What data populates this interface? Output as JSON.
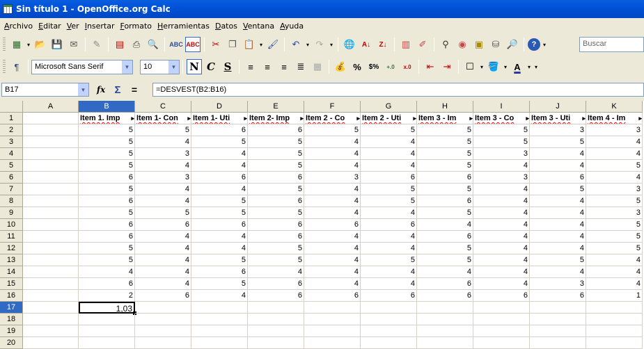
{
  "window": {
    "title": "Sin título 1 - OpenOffice.org Calc"
  },
  "menu": [
    "Archivo",
    "Editar",
    "Ver",
    "Insertar",
    "Formato",
    "Herramientas",
    "Datos",
    "Ventana",
    "Ayuda"
  ],
  "toolbar": {
    "search_placeholder": "Buscar",
    "font_name": "Microsoft Sans Serif",
    "font_size": "10",
    "bold_label": "N",
    "italic_label": "C",
    "underline_label": "S",
    "percent_label": "%"
  },
  "formula_bar": {
    "cell_ref": "B17",
    "formula": "=DESVEST(B2:B16)",
    "fx_label": "fx",
    "sum_label": "Σ",
    "equals_label": "="
  },
  "sheet": {
    "columns": [
      "A",
      "B",
      "C",
      "D",
      "E",
      "F",
      "G",
      "H",
      "I",
      "J",
      "K"
    ],
    "selected_column": "B",
    "selected_row": 17,
    "rows": [
      "1",
      "2",
      "3",
      "4",
      "5",
      "6",
      "7",
      "8",
      "9",
      "10",
      "11",
      "12",
      "13",
      "14",
      "15",
      "16",
      "17",
      "18",
      "19",
      "20"
    ],
    "headers": [
      "Item 1. Imp",
      "Item 1- Con",
      "Item 1- Uti",
      "Item 2- Imp",
      "Item 2 - Co",
      "Item 2 - Uti",
      "Item 3 - Im",
      "Item 3 - Co",
      "Item 3 - Uti",
      "Item 4 - Im"
    ],
    "data": [
      [
        5,
        5,
        6,
        6,
        5,
        5,
        5,
        5,
        3,
        3
      ],
      [
        5,
        4,
        5,
        5,
        4,
        4,
        5,
        5,
        5,
        4
      ],
      [
        5,
        3,
        4,
        5,
        4,
        4,
        5,
        3,
        4,
        4
      ],
      [
        5,
        4,
        4,
        5,
        4,
        4,
        5,
        4,
        4,
        5
      ],
      [
        6,
        3,
        6,
        6,
        3,
        6,
        6,
        3,
        6,
        4
      ],
      [
        5,
        4,
        4,
        5,
        4,
        5,
        5,
        4,
        5,
        3
      ],
      [
        6,
        4,
        5,
        6,
        4,
        5,
        6,
        4,
        4,
        5
      ],
      [
        5,
        5,
        5,
        5,
        4,
        4,
        5,
        4,
        4,
        3
      ],
      [
        6,
        6,
        6,
        6,
        6,
        6,
        4,
        4,
        4,
        5
      ],
      [
        6,
        4,
        4,
        6,
        4,
        4,
        6,
        4,
        4,
        5
      ],
      [
        5,
        4,
        4,
        5,
        4,
        4,
        5,
        4,
        4,
        5
      ],
      [
        5,
        4,
        5,
        5,
        4,
        5,
        5,
        4,
        5,
        4
      ],
      [
        4,
        4,
        6,
        4,
        4,
        4,
        4,
        4,
        4,
        4
      ],
      [
        6,
        4,
        5,
        6,
        4,
        4,
        6,
        4,
        3,
        4
      ],
      [
        2,
        6,
        4,
        6,
        6,
        6,
        6,
        6,
        6,
        1
      ]
    ],
    "result_value": "1,03"
  }
}
